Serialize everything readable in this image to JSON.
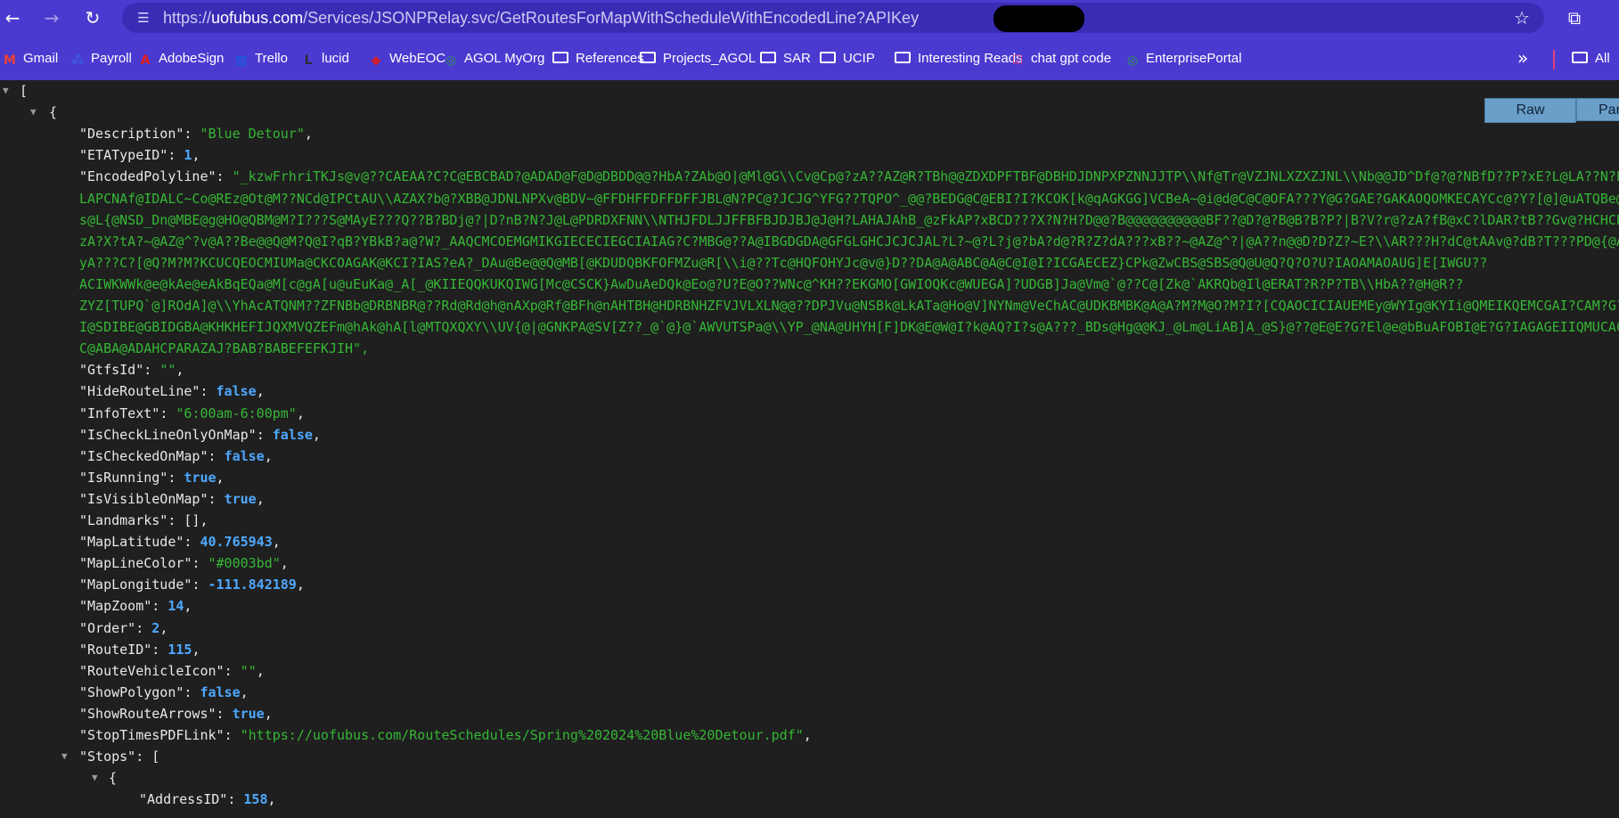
{
  "toolbar": {
    "back_glyph": "←",
    "forward_glyph": "→",
    "reload_glyph": "↻",
    "url_scheme": "https://",
    "url_host": "uofubus.com",
    "url_path": "/Services/JSONPRelay.svc/GetRoutesForMapWithScheduleWithEncodedLine?APIKey",
    "star_glyph": "☆",
    "extensions_glyph": "⧉"
  },
  "bookmarks": {
    "items": [
      {
        "label": "Gmail",
        "icon": "gmail-icon",
        "glyph": "M",
        "color": "#ea4335"
      },
      {
        "label": "Payroll",
        "icon": "payroll-icon",
        "glyph": "⁂",
        "color": "#3b5bdb"
      },
      {
        "label": "AdobeSign",
        "icon": "adobe-icon",
        "glyph": "A",
        "color": "#e0201b"
      },
      {
        "label": "Trello",
        "icon": "trello-icon",
        "glyph": "▥",
        "color": "#0c66e4"
      },
      {
        "label": "lucid",
        "icon": "lucid-icon",
        "glyph": "L",
        "color": "#282c33"
      },
      {
        "label": "WebEOC",
        "icon": "webeoc-icon",
        "glyph": "◆",
        "color": "#d02030"
      },
      {
        "label": "AGOL MyOrg",
        "icon": "globe-icon",
        "glyph": "◎",
        "color": "#2a9d4a"
      },
      {
        "label": "References",
        "icon": "folder-icon"
      },
      {
        "label": "Projects_AGOL",
        "icon": "folder-icon"
      },
      {
        "label": "SAR",
        "icon": "folder-icon"
      },
      {
        "label": "UCIP",
        "icon": "folder-icon"
      },
      {
        "label": "Interesting Reads",
        "icon": "folder-icon"
      },
      {
        "label": "chat gpt code",
        "icon": "checkbox-icon",
        "glyph": "☑",
        "color": "#d63384"
      },
      {
        "label": "EnterprisePortal",
        "icon": "globe-icon",
        "glyph": "◎",
        "color": "#2a9d4a"
      }
    ],
    "more_glyph": "»",
    "all_label": "All"
  },
  "viewer": {
    "raw_label": "Raw",
    "parsed_label": "Par"
  },
  "json": {
    "open_bracket": "[",
    "open_brace": "{",
    "lines": [
      {
        "key": "\"Description\"",
        "value": "\"Blue Detour\"",
        "type": "s"
      },
      {
        "key": "\"ETATypeID\"",
        "value": "1",
        "type": "n"
      },
      {
        "key": "\"GtfsId\"",
        "value": "\"\"",
        "type": "s"
      },
      {
        "key": "\"HideRouteLine\"",
        "value": "false",
        "type": "b"
      },
      {
        "key": "\"InfoText\"",
        "value": "\"6:00am-6:00pm\"",
        "type": "s"
      },
      {
        "key": "\"IsCheckLineOnlyOnMap\"",
        "value": "false",
        "type": "b"
      },
      {
        "key": "\"IsCheckedOnMap\"",
        "value": "false",
        "type": "b"
      },
      {
        "key": "\"IsRunning\"",
        "value": "true",
        "type": "b"
      },
      {
        "key": "\"IsVisibleOnMap\"",
        "value": "true",
        "type": "b"
      },
      {
        "key": "\"Landmarks\"",
        "value": "[]",
        "type": "k"
      },
      {
        "key": "\"MapLatitude\"",
        "value": "40.765943",
        "type": "n"
      },
      {
        "key": "\"MapLineColor\"",
        "value": "\"#0003bd\"",
        "type": "s"
      },
      {
        "key": "\"MapLongitude\"",
        "value": "-111.842189",
        "type": "n"
      },
      {
        "key": "\"MapZoom\"",
        "value": "14",
        "type": "n"
      },
      {
        "key": "\"Order\"",
        "value": "2",
        "type": "n"
      },
      {
        "key": "\"RouteID\"",
        "value": "115",
        "type": "n"
      },
      {
        "key": "\"RouteVehicleIcon\"",
        "value": "\"\"",
        "type": "s"
      },
      {
        "key": "\"ShowPolygon\"",
        "value": "false",
        "type": "b"
      },
      {
        "key": "\"ShowRouteArrows\"",
        "value": "true",
        "type": "b"
      },
      {
        "key": "\"StopTimesPDFLink\"",
        "value": "\"https://uofubus.com/RouteSchedules/Spring%202024%20Blue%20Detour.pdf\"",
        "type": "s"
      }
    ],
    "polyline_key": "\"EncodedPolyline\"",
    "polyline_lines": [
      "\"_kzwFrhriTKJs@v@??CAEAA?C?C@EBCBAD?@ADAD@F@D@DBDD@@?HbA?ZAb@O|@Ml@G\\\\Cv@Cp@?zA??AZ@R?TBh@@ZDXDPFTBF@DBHDJDNPXPZNNJJTP\\\\Nf@Tr@VZJNLXZXZJNL\\\\Nb@@JD^Df@?@?NBfD??P?xE?L@LA??N?L?",
      "LAPCNAf@IDALC~Co@REz@Ot@M??NCd@IPCtAU\\\\AZAX?b@?XBB@JDNLNPXv@BDV~@FFDHFFDFFDFFJBL@N?PC@?JCJG^YFG??TQPO^_@@?BEDG@C@EBI?I?KCOK[k@qAGKGG]VCBeA~@i@d@C@C@OFA???Y@G?GAE?GAKAOQOMKECAYCc@?Y?[@]@uATQBe@HC",
      "s@L{@NSD_Dn@MBE@g@HO@QBM@M?I???S@MAyE???Q??B?BDj@?|D?nB?N?J@L@PDRDXFNN\\\\NTHJFDLJJFFBFBJDJBJ@J@H?LAHAJAhB_@zFkAP?xBCD???X?N?H?D@@?B@@@@@@@@@@BF??@D?@?B@B?B?P?|B?V?r@?zA?fB@xC?lDAR?tB??Gv@?HCHCP~@Ai@",
      "zA?X?tA?~@AZ@^?v@A??Be@@Q@M?Q@I?qB?YBkB?a@?W?_AAQCMCOEMGMIKGIECECIEGCIAIAG?C?MBG@??A@IBGDGDA@GFGLGHCJCJCJAL?L?~@?L?j@?bA?d@?R?Z?dA???xB??~@AZ@^?|@A??n@@D?D?Z?~E?\\\\AR???H?dC@tAAv@?dB?T???PD@{@Ai@",
      "yA???C?[@Q?M?M?KCUCQEOCMIUMa@CKCOAGAK@KCI?IAS?eA?_DAu@Be@@Q@MB[@KDUDQBKFOFMZu@R[\\\\i@??Tc@HQFOHYJc@v@}D??DA@A@ABC@A@C@I@I?ICGAECEZ}CPk@ZwCBS@SBS@Q@U@Q?Q?O?U?IAOAMAOAUG]E[IWGU??",
      "ACIWKWWk@e@kAe@eAkBqEQa@M[c@gA[u@uEuKa@_A[_@KIIEQQKUKQIWG[Mc@CSCK}AwDuAeDQk@Eo@?U?E@O??WNc@^KH??EKGMO[GWIOQKc@WUEGA]?UDGB]Ja@Vm@`@??C@[Zk@`AKRQb@Il@ERAT?R?P?TB\\\\HbA??@H@R??",
      "ZYZ[TUPQ`@]ROdA]@\\\\YhAcATQNM??ZFNBb@DRBNBR@??Rd@Rd@h@nAXp@Rf@BFh@nAHTBH@HDRBNHZFVJVLXLN@@??DPJVu@NSBk@LkATa@Ho@V]NYNm@VeChAC@UDKBMBK@A@A?M?M@O?M?I?[CQAOCICIAUEMEy@WYIg@KYIi@QMEIKQEMCGAI?CAM?G?",
      "I@SDIBE@GBIDGBA@KHKHEFIJQXMVQZEFm@hAk@hA[l@MTQXQXY\\\\UV{@|@GNKPA@SV[Z??_@`@}@`AWVUTSPa@\\\\YP_@NA@UHYH[F]DK@E@W@I?k@AQ?I?s@A???_BDs@Hg@@KJ_@Lm@LiAB]A_@S}@??@E@E?G?El@e@bBuAFOBI@E?G?IAGAGEIIQMUCACAA",
      "C@ABA@ADAHCPARAZAJ?BAB?BABEFEFKJIH\","
    ],
    "stops_key": "\"Stops\"",
    "stops_open": "[",
    "stop_open_brace": "{",
    "address_key": "\"AddressID\"",
    "address_value": "158"
  }
}
